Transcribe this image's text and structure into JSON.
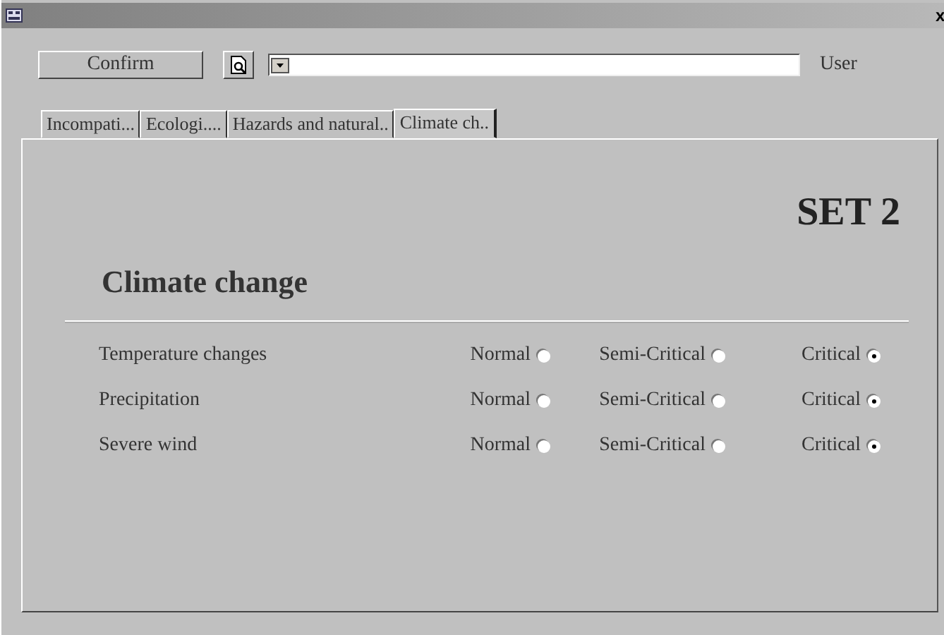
{
  "window": {
    "close": "x"
  },
  "toolbar": {
    "confirm": "Confirm",
    "user_label": "User"
  },
  "tabs": [
    {
      "label": "Incompati...",
      "selected": false
    },
    {
      "label": "Ecologi....",
      "selected": false
    },
    {
      "label": "Hazards and natural..",
      "selected": false
    },
    {
      "label": "Climate ch..",
      "selected": true
    }
  ],
  "panel": {
    "set_label": "SET 2",
    "heading": "Climate change",
    "rows": [
      {
        "label": "Temperature changes",
        "options": [
          {
            "label": "Normal",
            "selected": false
          },
          {
            "label": "Semi-Critical",
            "selected": false
          },
          {
            "label": "Critical",
            "selected": true
          }
        ]
      },
      {
        "label": "Precipitation",
        "options": [
          {
            "label": "Normal",
            "selected": false
          },
          {
            "label": "Semi-Critical",
            "selected": false
          },
          {
            "label": "Critical",
            "selected": true
          }
        ]
      },
      {
        "label": "Severe wind",
        "options": [
          {
            "label": "Normal",
            "selected": false
          },
          {
            "label": "Semi-Critical",
            "selected": false
          },
          {
            "label": "Critical",
            "selected": true
          }
        ]
      }
    ]
  }
}
